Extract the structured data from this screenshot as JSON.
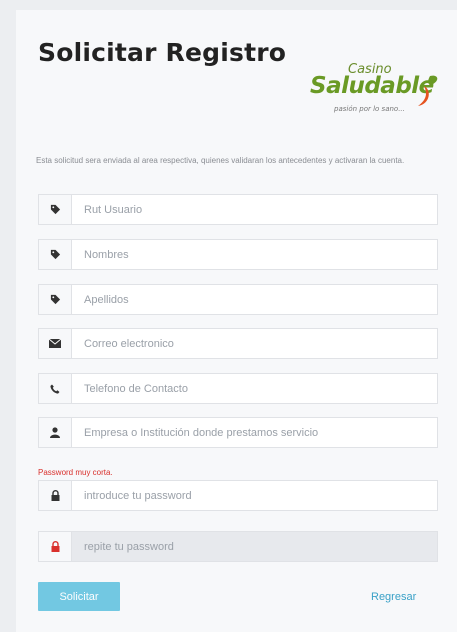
{
  "page": {
    "title": "Solicitar Registro",
    "info": "Esta solicitud sera enviada al area respectiva, quienes validaran los antecedentes y activaran la cuenta."
  },
  "logo": {
    "casino": "Casino",
    "main": "Saludable",
    "tagline": "pasión por lo sano..."
  },
  "form": {
    "fields": [
      {
        "icon": "tag-icon",
        "placeholder": "Rut Usuario",
        "value": ""
      },
      {
        "icon": "tag-icon",
        "placeholder": "Nombres",
        "value": ""
      },
      {
        "icon": "tag-icon",
        "placeholder": "Apellidos",
        "value": ""
      },
      {
        "icon": "envelope-icon",
        "placeholder": "Correo electronico",
        "value": ""
      },
      {
        "icon": "phone-icon",
        "placeholder": "Telefono de Contacto",
        "value": ""
      },
      {
        "icon": "user-icon",
        "placeholder": "Empresa o Institución donde prestamos servicio",
        "value": ""
      },
      {
        "icon": "lock-icon",
        "placeholder": "introduce tu password",
        "value": ""
      },
      {
        "icon": "lock-icon",
        "placeholder": "repite tu password",
        "value": ""
      }
    ],
    "password_error": "Password muy corta.",
    "submit_label": "Solicitar",
    "back_label": "Regresar"
  },
  "colors": {
    "accent": "#5bc0de",
    "link": "#3aa1c7",
    "error": "#d9302c",
    "logo_green": "#6a9a25",
    "logo_orange": "#e5531f"
  }
}
